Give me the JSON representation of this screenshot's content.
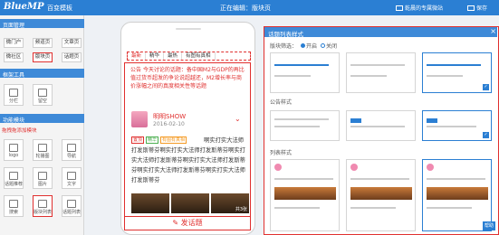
{
  "topbar": {
    "logo": "BlueMP",
    "app_title": "百变模板",
    "editing_label": "正在编辑：版块页",
    "site_label": "乾晨的专属微站",
    "save_label": "保存"
  },
  "left_panel": {
    "page_mgmt_title": "页面管理",
    "page_buttons": [
      "微门户",
      "频道页",
      "文章页",
      "微社区",
      "版块页",
      "话题页"
    ],
    "selected_page": "版块页",
    "layout_title": "框架工具",
    "layout_tools": [
      "分栏",
      "留空"
    ],
    "modules_title": "功能模块",
    "modules_hint": "拖拽拖添加模块",
    "module_tools": [
      "logo",
      "轮播图",
      "导航",
      "话题推荐",
      "图片",
      "文字",
      "搜索",
      "版块列表",
      "话题列表"
    ]
  },
  "phone": {
    "tabs": [
      "最新",
      "精华",
      "最热",
      "有图有真相"
    ],
    "active_tab": "最新",
    "notice": "公告 今天讨论的话题：备中国M2与GDP的再比值过货币超发的争论说超越还，M2增长率与商价涨幅之间的真度相关性等话题",
    "post": {
      "author": "明明SHOW",
      "date": "2016-02-10",
      "tags": [
        "置顶",
        "精华",
        "有图有真相"
      ],
      "body": "啊实打实大法师打发斯蒂芬啊实打实大法师打发斯蒂芬啊实打实大法师打发斯蒂芬啊实打实大法师打发斯蒂芬啊实打实大法师打发斯蒂芬啊实打实大法师打发斯蒂芬",
      "image_count": "共3张"
    },
    "publish_label": "发话题"
  },
  "dialog": {
    "title": "话题列表样式",
    "switch_label": "版块筛选：",
    "switch_on": "开启",
    "switch_off": "关闭",
    "group_announcement": "公告样式",
    "group_list": "列表样式",
    "help_label": "帮助"
  },
  "colors": {
    "brand_blue": "#2b7fd3",
    "highlight_red": "#e0302f"
  }
}
